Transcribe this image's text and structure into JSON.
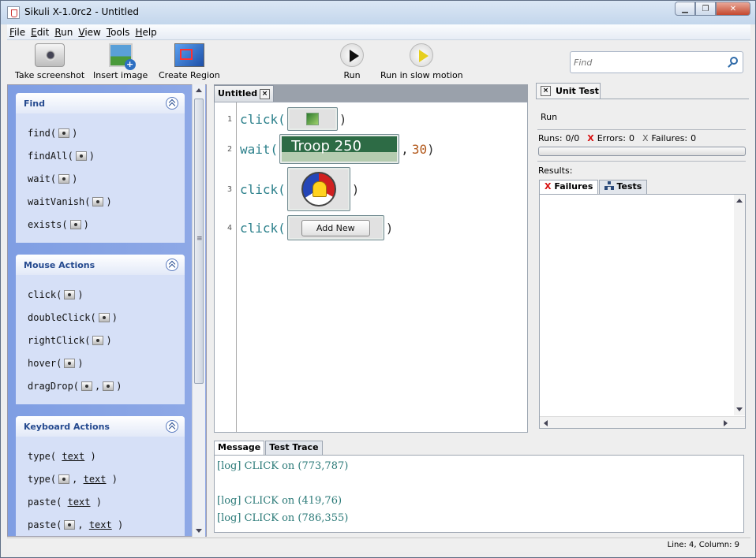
{
  "window": {
    "title": "Sikuli X-1.0rc2 - Untitled"
  },
  "menu": [
    "File",
    "Edit",
    "Run",
    "View",
    "Tools",
    "Help"
  ],
  "toolbar": {
    "take_screenshot": "Take screenshot",
    "insert_image": "Insert image",
    "create_region": "Create Region",
    "run": "Run",
    "run_slow": "Run in slow motion",
    "search_placeholder": "Find"
  },
  "commands": {
    "find": {
      "title": "Find",
      "items": [
        {
          "fn": "find(",
          "end": ")"
        },
        {
          "fn": "findAll(",
          "end": ")"
        },
        {
          "fn": "wait(",
          "end": ")"
        },
        {
          "fn": "waitVanish(",
          "end": ")"
        },
        {
          "fn": "exists(",
          "end": ")"
        }
      ]
    },
    "mouse": {
      "title": "Mouse Actions",
      "items": [
        {
          "fn": "click(",
          "end": ")"
        },
        {
          "fn": "doubleClick(",
          "end": ")"
        },
        {
          "fn": "rightClick(",
          "end": ")"
        },
        {
          "fn": "hover(",
          "end": ")"
        },
        {
          "fn": "dragDrop(",
          "sep": ",",
          "end": ")"
        }
      ]
    },
    "keyboard": {
      "title": "Keyboard Actions",
      "items": [
        {
          "fn": "type(",
          "arg": "text",
          "end": ")"
        },
        {
          "fn": "type(",
          "sep": ",",
          "arg": "text",
          "end": ")"
        },
        {
          "fn": "paste(",
          "arg": "text",
          "end": ")"
        },
        {
          "fn": "paste(",
          "sep": ",",
          "arg": "text",
          "end": ")"
        }
      ]
    }
  },
  "editor": {
    "tab_title": "Untitled",
    "tab_close": "×",
    "lines": [
      {
        "no": "1",
        "fn": "click(",
        "end": ")"
      },
      {
        "no": "2",
        "fn": "wait(",
        "pattern_text": "Troop 250",
        "sep": ",",
        "arg": "30",
        "end": ")"
      },
      {
        "no": "3",
        "fn": "click(",
        "end": ")"
      },
      {
        "no": "4",
        "fn": "click(",
        "pattern_text": "Add New",
        "end": ")"
      }
    ]
  },
  "unit_test": {
    "tab": "Unit Test",
    "run": "Run",
    "runs_label": "Runs:",
    "runs_value": "0/0",
    "errors_label": "Errors:",
    "errors_value": "0",
    "failures_label": "Failures:",
    "failures_value": "0",
    "results_label": "Results:",
    "tab_failures": "Failures",
    "tab_tests": "Tests",
    "x": "X"
  },
  "messages": {
    "tabs": [
      "Message",
      "Test Trace"
    ],
    "log": [
      "[log] CLICK on (773,787)",
      "",
      "[log] CLICK on (419,76)",
      "[log] CLICK on (786,355)"
    ]
  },
  "status": {
    "text": "Line: 4, Column: 9"
  }
}
